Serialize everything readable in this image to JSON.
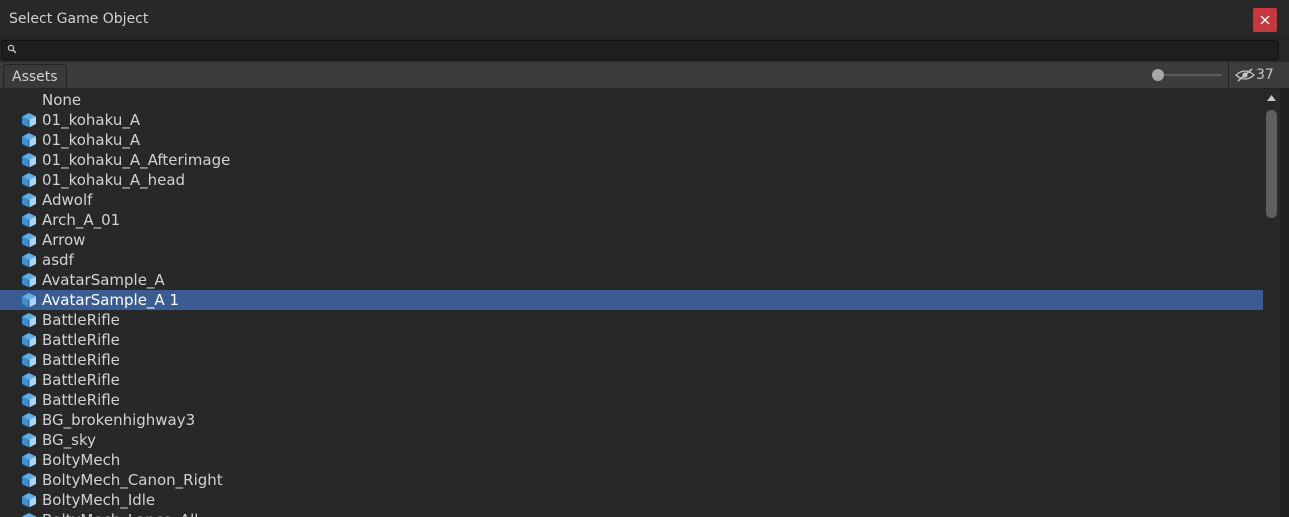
{
  "window": {
    "title": "Select Game Object"
  },
  "search": {
    "value": "",
    "placeholder": ""
  },
  "toolbar": {
    "tab_label": "Assets",
    "hidden_count": "37",
    "zoom_level": 0
  },
  "list": {
    "selected_index": 9,
    "items": [
      {
        "label": "None",
        "icon": "none"
      },
      {
        "label": "01_kohaku_A",
        "icon": "prefab-icon"
      },
      {
        "label": "01_kohaku_A",
        "icon": "prefab-icon"
      },
      {
        "label": "01_kohaku_A_Afterimage",
        "icon": "prefab-icon"
      },
      {
        "label": "01_kohaku_A_head",
        "icon": "prefab-icon"
      },
      {
        "label": "Adwolf",
        "icon": "prefab-icon"
      },
      {
        "label": "Arch_A_01",
        "icon": "prefab-icon"
      },
      {
        "label": "Arrow",
        "icon": "prefab-icon"
      },
      {
        "label": "asdf",
        "icon": "prefab-icon"
      },
      {
        "label": "AvatarSample_A",
        "icon": "prefab-icon"
      },
      {
        "label": "AvatarSample_A 1",
        "icon": "prefab-icon"
      },
      {
        "label": "BattleRifle",
        "icon": "prefab-icon"
      },
      {
        "label": "BattleRifle",
        "icon": "prefab-icon"
      },
      {
        "label": "BattleRifle",
        "icon": "prefab-icon"
      },
      {
        "label": "BattleRifle",
        "icon": "prefab-icon"
      },
      {
        "label": "BattleRifle",
        "icon": "prefab-icon"
      },
      {
        "label": "BG_brokenhighway3",
        "icon": "prefab-icon"
      },
      {
        "label": "BG_sky",
        "icon": "prefab-icon"
      },
      {
        "label": "BoltyMech",
        "icon": "prefab-icon"
      },
      {
        "label": "BoltyMech_Canon_Right",
        "icon": "prefab-icon"
      },
      {
        "label": "BoltyMech_Idle",
        "icon": "prefab-icon"
      },
      {
        "label": "BoltyMech_Lance_All",
        "icon": "prefab-icon"
      }
    ]
  },
  "colors": {
    "background": "#282828",
    "selection": "#3b5b93",
    "close_button": "#c5393e",
    "prefab_icon": "#5fb0e8"
  }
}
